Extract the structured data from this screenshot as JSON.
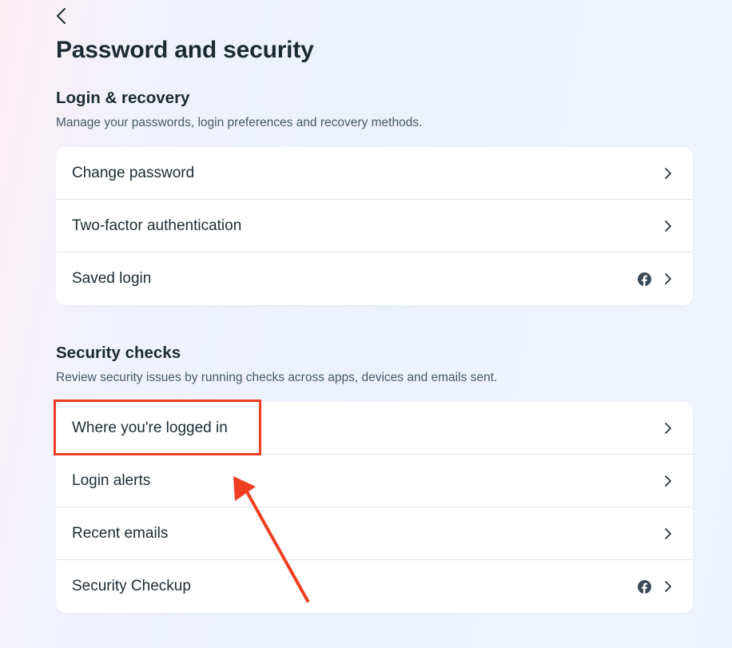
{
  "page": {
    "title": "Password and security",
    "back_icon": "chevron-left-icon"
  },
  "sections": [
    {
      "title": "Login & recovery",
      "description": "Manage your passwords, login preferences and recovery methods.",
      "items": [
        {
          "label": "Change password",
          "trailing_icon": "chevron-right-icon"
        },
        {
          "label": "Two-factor authentication",
          "trailing_icon": "chevron-right-icon"
        },
        {
          "label": "Saved login",
          "badge_icon": "facebook-icon",
          "trailing_icon": "chevron-right-icon"
        }
      ]
    },
    {
      "title": "Security checks",
      "description": "Review security issues by running checks across apps, devices and emails sent.",
      "items": [
        {
          "label": "Where you're logged in",
          "trailing_icon": "chevron-right-icon",
          "highlighted": true
        },
        {
          "label": "Login alerts",
          "trailing_icon": "chevron-right-icon"
        },
        {
          "label": "Recent emails",
          "trailing_icon": "chevron-right-icon"
        },
        {
          "label": "Security Checkup",
          "badge_icon": "facebook-icon",
          "trailing_icon": "chevron-right-icon"
        }
      ]
    }
  ],
  "annotation": {
    "highlight_color": "#ee3d21",
    "arrow_color": "#ee3d21",
    "arrow_icon": "arrow-annotation"
  },
  "colors": {
    "text_primary": "#1c2b33",
    "text_secondary": "#465a69",
    "divider": "#dee3e9",
    "card_background": "#ffffff"
  }
}
